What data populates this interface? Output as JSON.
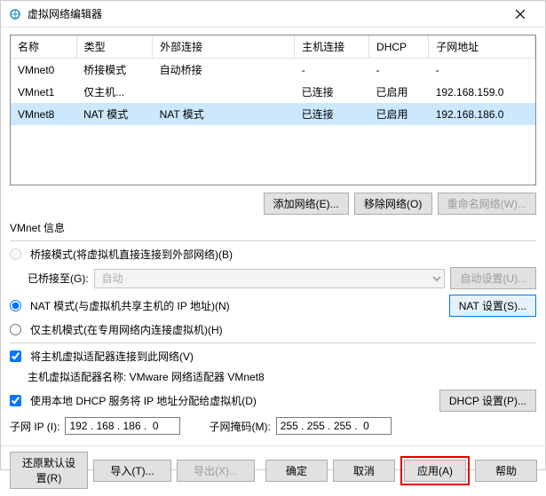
{
  "window": {
    "title": "虚拟网络编辑器"
  },
  "table": {
    "headers": [
      "名称",
      "类型",
      "外部连接",
      "主机连接",
      "DHCP",
      "子网地址"
    ],
    "rows": [
      {
        "name": "VMnet0",
        "type": "桥接模式",
        "ext": "自动桥接",
        "host": "-",
        "dhcp": "-",
        "subnet": "-",
        "selected": false
      },
      {
        "name": "VMnet1",
        "type": "仅主机...",
        "ext": "",
        "host": "已连接",
        "dhcp": "已启用",
        "subnet": "192.168.159.0",
        "selected": false
      },
      {
        "name": "VMnet8",
        "type": "NAT 模式",
        "ext": "NAT 模式",
        "host": "已连接",
        "dhcp": "已启用",
        "subnet": "192.168.186.0",
        "selected": true
      }
    ]
  },
  "buttons": {
    "add_net": "添加网络(E)...",
    "remove_net": "移除网络(O)",
    "rename_net": "重命名网络(W)...",
    "auto_set": "自动设置(U)...",
    "nat_set": "NAT 设置(S)...",
    "dhcp_set": "DHCP 设置(P)...",
    "restore": "还原默认设置(R)",
    "import": "导入(T)...",
    "export": "导出(X)...",
    "ok": "确定",
    "cancel": "取消",
    "apply": "应用(A)",
    "help": "帮助"
  },
  "labels": {
    "section": "VMnet 信息",
    "bridge": "桥接模式(将虚拟机直接连接到外部网络)(B)",
    "bridged_to": "已桥接至(G):",
    "bridged_opt": "自动",
    "nat": "NAT 模式(与虚拟机共享主机的 IP 地址)(N)",
    "hostonly": "仅主机模式(在专用网络内连接虚拟机)(H)",
    "connect_host": "将主机虚拟适配器连接到此网络(V)",
    "adapter_name": "主机虚拟适配器名称: VMware 网络适配器 VMnet8",
    "use_dhcp": "使用本地 DHCP 服务将 IP 地址分配给虚拟机(D)",
    "subnet_ip": "子网 IP (I):",
    "subnet_mask": "子网掩码(M):"
  },
  "fields": {
    "subnet_ip": "192 . 168 . 186 .  0",
    "subnet_mask": "255 . 255 . 255 .  0"
  }
}
